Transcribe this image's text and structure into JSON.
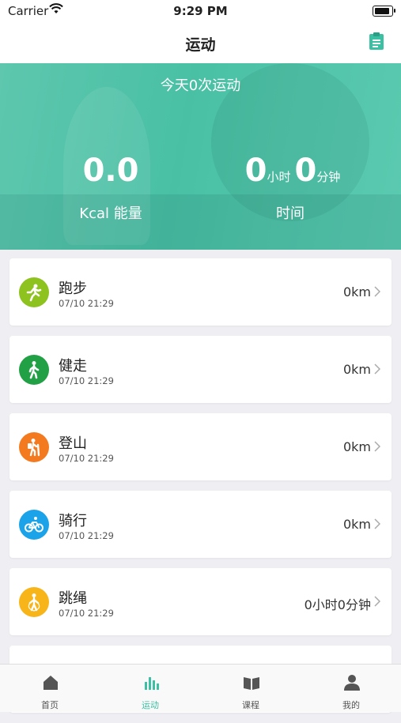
{
  "status_bar": {
    "carrier": "Carrier",
    "time": "9:29 PM",
    "battery_level": 1.0
  },
  "nav": {
    "title": "运动",
    "right_icon": "clipboard-icon"
  },
  "hero": {
    "headline": "今天0次运动",
    "energy_value": "0.0",
    "energy_label": "Kcal 能量",
    "hours_value": "0",
    "hours_unit": "小时",
    "minutes_value": "0",
    "minutes_unit": "分钟",
    "time_label": "时间",
    "accent": "#4bc2a6"
  },
  "activities": [
    {
      "name": "跑步",
      "date": "07/10 21:29",
      "value": "0km",
      "icon": "running-icon",
      "color": "#8dc21f"
    },
    {
      "name": "健走",
      "date": "07/10 21:29",
      "value": "0km",
      "icon": "walking-icon",
      "color": "#22a045"
    },
    {
      "name": "登山",
      "date": "07/10 21:29",
      "value": "0km",
      "icon": "hiking-icon",
      "color": "#f47a20"
    },
    {
      "name": "骑行",
      "date": "07/10 21:29",
      "value": "0km",
      "icon": "cycling-icon",
      "color": "#1aa3e8"
    },
    {
      "name": "跳绳",
      "date": "07/10 21:29",
      "value": "0小时0分钟",
      "icon": "jump-rope-icon",
      "color": "#f7b51a"
    }
  ],
  "tabs": [
    {
      "label": "首页",
      "icon": "home-icon",
      "active": false
    },
    {
      "label": "运动",
      "icon": "bar-chart-icon",
      "active": true
    },
    {
      "label": "课程",
      "icon": "book-icon",
      "active": false
    },
    {
      "label": "我的",
      "icon": "person-icon",
      "active": false
    }
  ]
}
